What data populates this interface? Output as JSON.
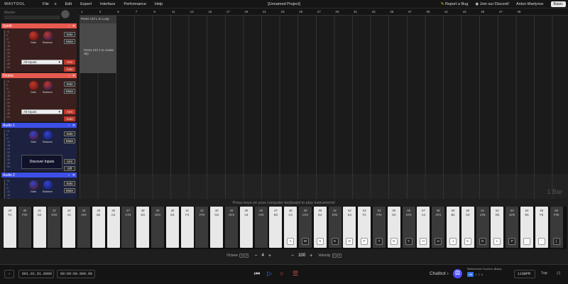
{
  "menubar": {
    "logo": "WAVTOOL",
    "items": [
      "File",
      "Edit",
      "Expert",
      "Interface",
      "Performance",
      "Help"
    ],
    "file_icon": "≡",
    "title": "[Unnamed Project]",
    "report_bug": "Report a Bug",
    "discord": "Join our Discord!",
    "user": "Anton Martynov",
    "basic": "Basic"
  },
  "master": {
    "label": "Master"
  },
  "meter_ticks": [
    "+6",
    "0",
    "-6",
    "-12",
    "-18",
    "-24",
    "-30",
    "-36",
    "-42",
    "-48",
    "-54"
  ],
  "tracks": [
    {
      "name": "Synth",
      "color": "#e85a4f",
      "bg": "#3a1f1f",
      "knob_color": "#c0392b",
      "solo": "Solo",
      "mute": "Mute",
      "input": "All Inputs",
      "arm": "Arm",
      "auto": "Auto",
      "gain": "Gain",
      "balance": "Balance"
    },
    {
      "name": "Drums",
      "color": "#e85a4f",
      "bg": "#3a1f1f",
      "knob_color": "#c0392b",
      "solo": "Solo",
      "mute": "Mute",
      "input": "All Inputs",
      "arm": "Arm",
      "auto": "Auto",
      "gain": "Gain",
      "balance": "Balance"
    },
    {
      "name": "Audio 1",
      "color": "#3d4fe6",
      "bg": "#1c2140",
      "knob_color": "#3344cc",
      "solo": "Solo",
      "mute": "Mute",
      "discover": "Discover Inputs",
      "arm": "Arm",
      "off": "Off",
      "gain": "Gain",
      "balance": "Balance"
    },
    {
      "name": "Audio 2",
      "color": "#3d4fe6",
      "bg": "#1c2140",
      "knob_color": "#3344cc",
      "solo": "Solo",
      "mute": "Mute",
      "gain": "Gain",
      "balance": "Balance"
    }
  ],
  "timeline": {
    "ruler": [
      "1",
      "3",
      "5",
      "7",
      "9",
      "11",
      "13",
      "15",
      "17",
      "19",
      "21",
      "23",
      "25",
      "27",
      "29",
      "31",
      "33",
      "35",
      "37",
      "39",
      "41",
      "43",
      "45",
      "47",
      "49"
    ],
    "loop_hint": "Press Ctrl L to Loop",
    "clip_hint": "Press Ctrl J to create clip",
    "bar_size": "1 Bar"
  },
  "piano": {
    "hint": "Press keys on your computer keyboard to play instruments!",
    "keys": [
      {
        "n": "29",
        "m": "F2",
        "b": false
      },
      {
        "n": "30",
        "m": "F#2",
        "b": true
      },
      {
        "n": "31",
        "m": "G2",
        "b": false
      },
      {
        "n": "32",
        "m": "G#2",
        "b": true
      },
      {
        "n": "33",
        "m": "A2",
        "b": false
      },
      {
        "n": "34",
        "m": "A#2",
        "b": true
      },
      {
        "n": "35",
        "m": "B2",
        "b": false
      },
      {
        "n": "36",
        "m": "C3",
        "b": false
      },
      {
        "n": "37",
        "m": "C#3",
        "b": true
      },
      {
        "n": "38",
        "m": "D3",
        "b": false
      },
      {
        "n": "39",
        "m": "D#3",
        "b": true
      },
      {
        "n": "40",
        "m": "E3",
        "b": false
      },
      {
        "n": "41",
        "m": "F3",
        "b": false
      },
      {
        "n": "42",
        "m": "F#3",
        "b": true
      },
      {
        "n": "43",
        "m": "G3",
        "b": false
      },
      {
        "n": "44",
        "m": "G#3",
        "b": true
      },
      {
        "n": "45",
        "m": "A3",
        "b": false
      },
      {
        "n": "46",
        "m": "A#3",
        "b": true
      },
      {
        "n": "47",
        "m": "B3",
        "b": false
      },
      {
        "n": "48",
        "m": "C4",
        "b": false,
        "k": "A"
      },
      {
        "n": "49",
        "m": "C#4",
        "b": true,
        "k": "W"
      },
      {
        "n": "50",
        "m": "D4",
        "b": false,
        "k": "S"
      },
      {
        "n": "51",
        "m": "D#4",
        "b": true,
        "k": "E"
      },
      {
        "n": "52",
        "m": "E4",
        "b": false,
        "k": "D"
      },
      {
        "n": "53",
        "m": "F4",
        "b": false,
        "k": "F"
      },
      {
        "n": "54",
        "m": "F#4",
        "b": true,
        "k": "T"
      },
      {
        "n": "55",
        "m": "G4",
        "b": false,
        "k": "G"
      },
      {
        "n": "56",
        "m": "G#4",
        "b": true,
        "k": "Y"
      },
      {
        "n": "57",
        "m": "A4",
        "b": false,
        "k": "H"
      },
      {
        "n": "58",
        "m": "A#4",
        "b": true,
        "k": "U"
      },
      {
        "n": "59",
        "m": "B4",
        "b": false,
        "k": "J"
      },
      {
        "n": "60",
        "m": "C5",
        "b": false,
        "k": "K"
      },
      {
        "n": "61",
        "m": "C#5",
        "b": true,
        "k": "O"
      },
      {
        "n": "62",
        "m": "D5",
        "b": false,
        "k": "L"
      },
      {
        "n": "63",
        "m": "D#5",
        "b": true,
        "k": "P"
      },
      {
        "n": "64",
        "m": "E5",
        "b": false,
        "k": ";"
      },
      {
        "n": "65",
        "m": "F5",
        "b": false,
        "k": "'"
      },
      {
        "n": "66",
        "m": "F#5",
        "b": true,
        "k": "]"
      }
    ]
  },
  "controls": {
    "octave_label": "Octave",
    "octave_key_down": "Z",
    "octave_key_up": "X",
    "octave": "4",
    "velocity_label": "Velocity",
    "velocity_key_down": "C",
    "velocity_key_up": "V",
    "velocity": "100"
  },
  "transport": {
    "position": "001.01.01.0000",
    "time": "00:00:00.000.00",
    "chatbot": "Chatbot",
    "metronome": "Metronome Count-in (Bars)",
    "metro_off": "Off",
    "metro_opts": [
      "1",
      "2",
      "4"
    ],
    "bpm": "118BPM",
    "sig": "Top"
  }
}
